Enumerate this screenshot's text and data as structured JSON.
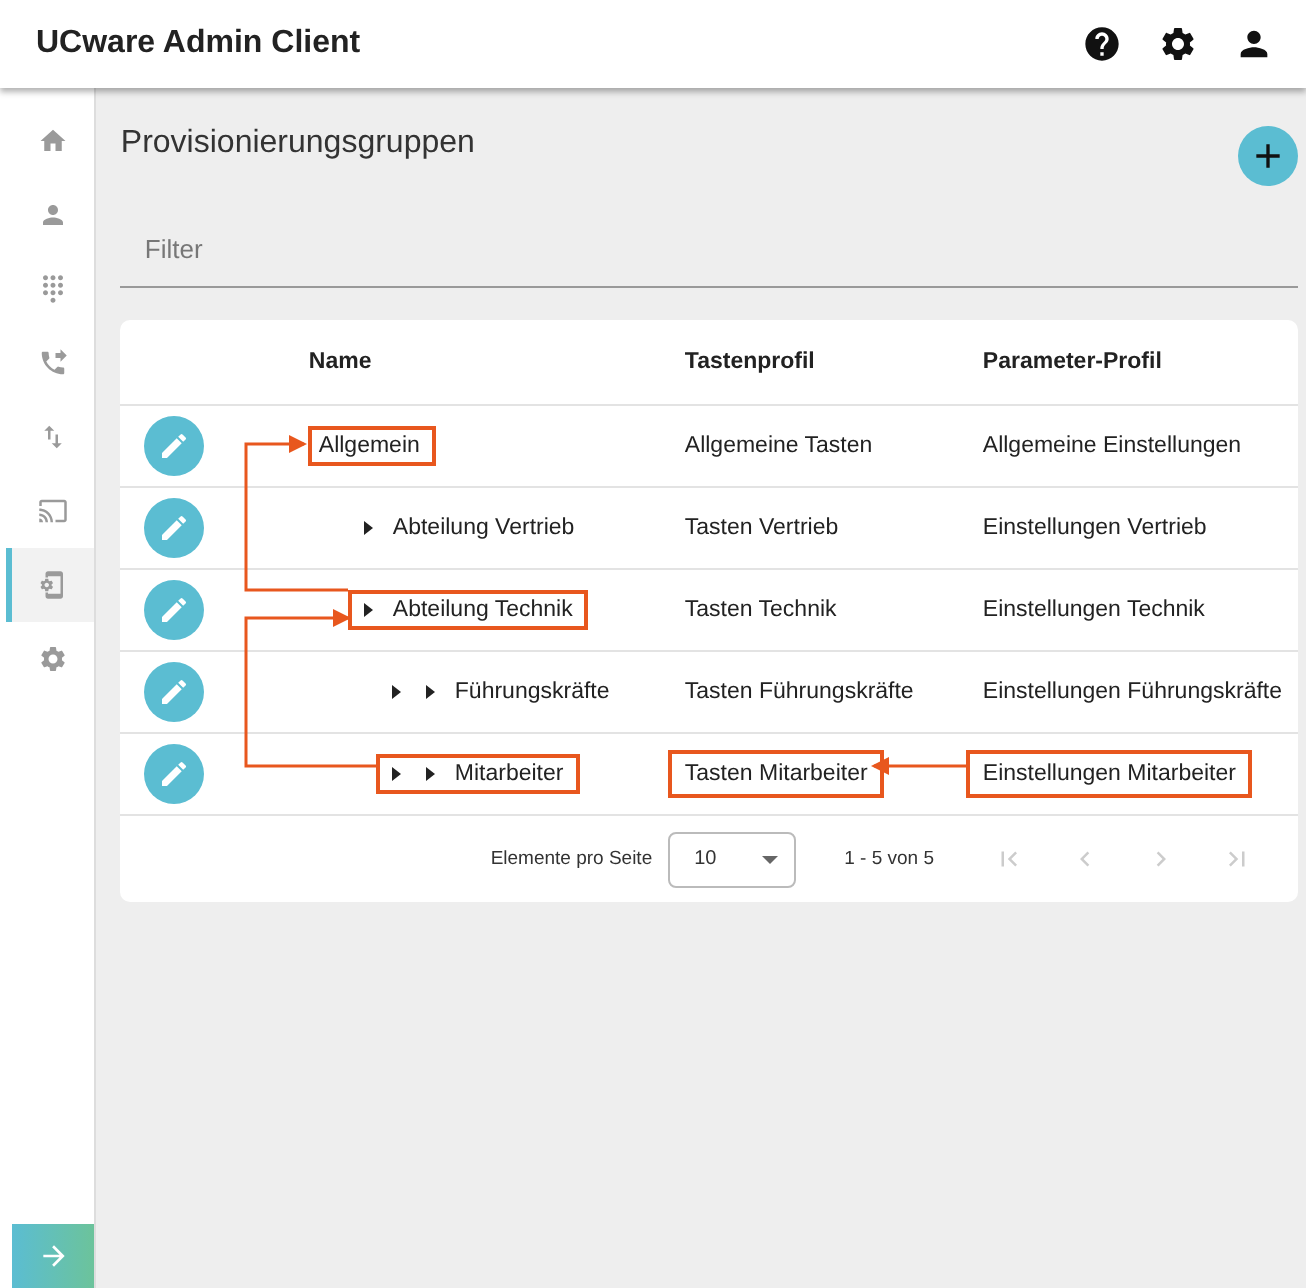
{
  "app_bar": {
    "title": "UCware Admin Client"
  },
  "sidebar": {
    "items": [
      {
        "selected": false
      },
      {
        "selected": false
      },
      {
        "selected": false
      },
      {
        "selected": false
      },
      {
        "selected": false
      },
      {
        "selected": false
      },
      {
        "selected": true
      },
      {
        "selected": false
      }
    ]
  },
  "page": {
    "title": "Provisionierungsgruppen"
  },
  "filter": {
    "placeholder": "Filter"
  },
  "table": {
    "columns": [
      "Name",
      "Tastenprofil",
      "Parameter-Profil"
    ],
    "rows": [
      {
        "name": "Allgemein",
        "tastenprofil": "Allgemeine Tasten",
        "parameter_profil": "Allgemeine Einstellungen",
        "highlighted": true,
        "profiles_highlighted": false,
        "children": [
          {
            "name": "Abteilung Vertrieb",
            "tastenprofil": "Tasten Vertrieb",
            "parameter_profil": "Einstellungen Vertrieb",
            "highlighted": false,
            "profiles_highlighted": false
          },
          {
            "name": "Abteilung Technik",
            "tastenprofil": "Tasten Technik",
            "parameter_profil": "Einstellungen Technik",
            "highlighted": true,
            "profiles_highlighted": false,
            "children": [
              {
                "name": "Führungskräfte",
                "tastenprofil": "Tasten Führungskräfte",
                "parameter_profil": "Einstellungen Führungskräfte",
                "highlighted": false,
                "profiles_highlighted": false
              },
              {
                "name": "Mitarbeiter",
                "tastenprofil": "Tasten Mitarbeiter",
                "parameter_profil": "Einstellungen Mitarbeiter",
                "highlighted": true,
                "profiles_highlighted": true
              }
            ]
          }
        ]
      }
    ]
  },
  "pagination": {
    "label": "Elemente pro Seite",
    "page_size": "10",
    "range": "1 - 5 von 5",
    "buttons": [
      {
        "disabled": true
      },
      {
        "disabled": true
      },
      {
        "disabled": true
      },
      {
        "disabled": true
      }
    ]
  }
}
